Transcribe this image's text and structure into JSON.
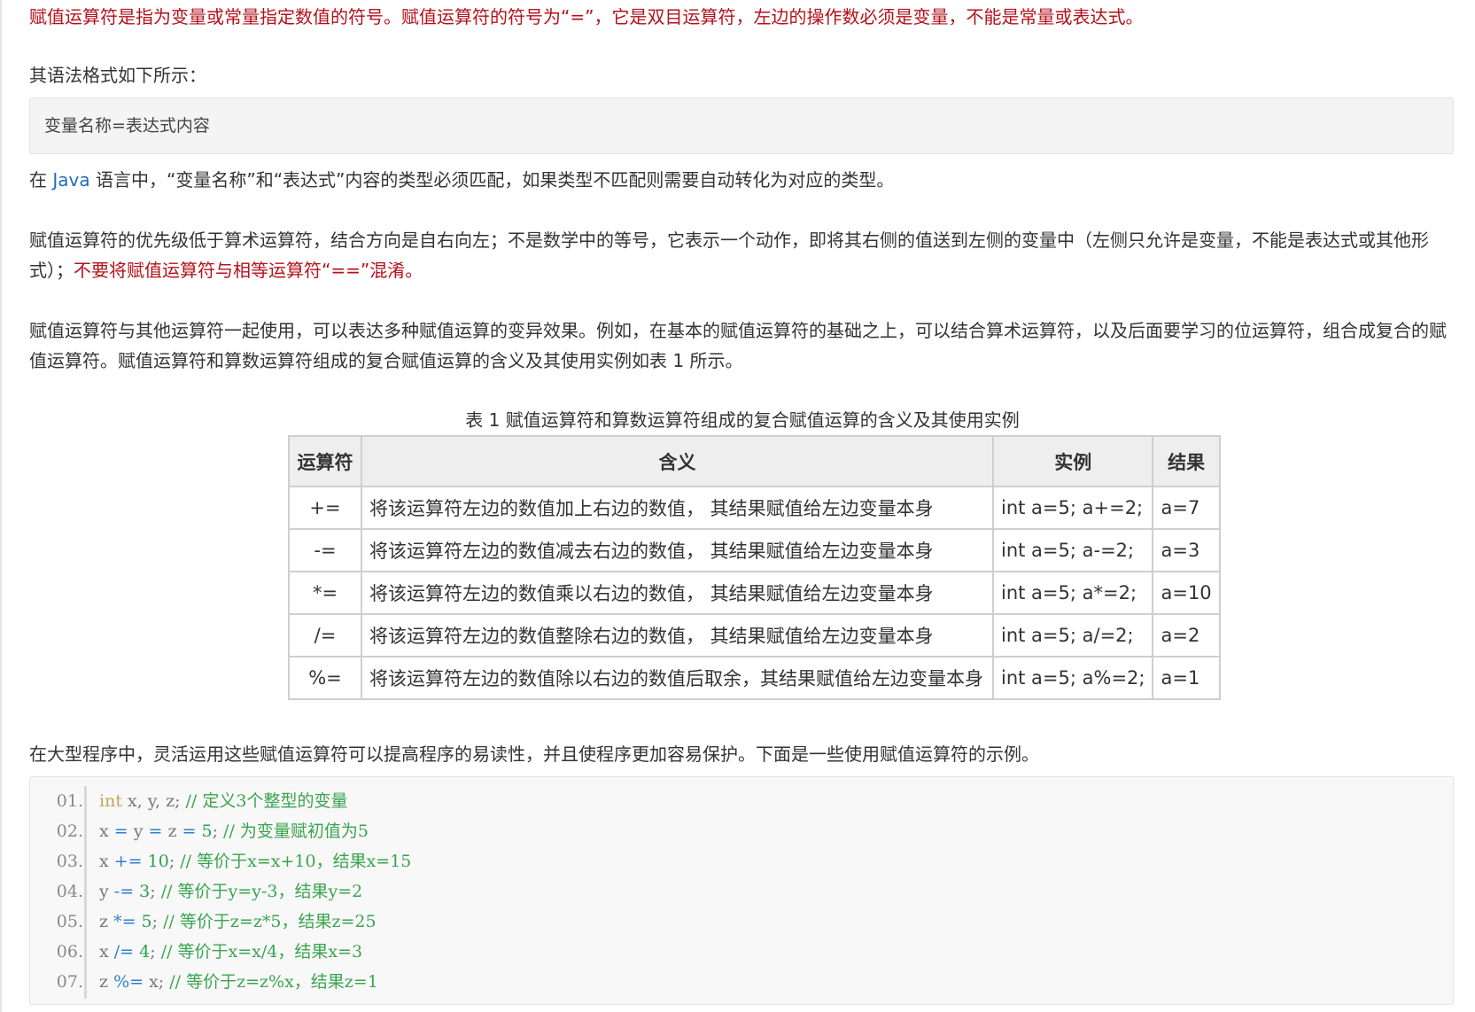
{
  "para1": "赋值运算符是指为变量或常量指定数值的符号。赋值运算符的符号为“=”，它是双目运算符，左边的操作数必须是变量，不能是常量或表达式。",
  "para2": "其语法格式如下所示：",
  "syntax": "变量名称=表达式内容",
  "para3": {
    "prefix": "在 ",
    "link": "Java",
    "suffix": " 语言中，“变量名称”和“表达式”内容的类型必须匹配，如果类型不匹配则需要自动转化为对应的类型。"
  },
  "para4": {
    "normal": "赋值运算符的优先级低于算术运算符，结合方向是自右向左；不是数学中的等号，它表示一个动作，即将其右侧的值送到左侧的变量中（左侧只允许是变量，不能是表达式或其他形式）；",
    "red": "不要将赋值运算符与相等运算符“==”混淆。"
  },
  "para5": "赋值运算符与其他运算符一起使用，可以表达多种赋值运算的变异效果。例如，在基本的赋值运算符的基础之上，可以结合算术运算符，以及后面要学习的位运算符，组合成复合的赋值运算符。赋值运算符和算数运算符组成的复合赋值运算的含义及其使用实例如表 1 所示。",
  "table": {
    "caption": "表 1 赋值运算符和算数运算符组成的复合赋值运算的含义及其使用实例",
    "headers": [
      "运算符",
      "含义",
      "实例",
      "结果"
    ],
    "rows": [
      [
        "+=",
        "将该运算符左边的数值加上右边的数值， 其结果赋值给左边变量本身",
        "int a=5; a+=2;",
        "a=7"
      ],
      [
        "-=",
        "将该运算符左边的数值减去右边的数值， 其结果赋值给左边变量本身",
        "int a=5; a-=2;",
        "a=3"
      ],
      [
        "*=",
        "将该运算符左边的数值乘以右边的数值， 其结果赋值给左边变量本身",
        "int a=5; a*=2;",
        "a=10"
      ],
      [
        "/=",
        "将该运算符左边的数值整除右边的数值， 其结果赋值给左边变量本身",
        "int a=5; a/=2;",
        "a=2"
      ],
      [
        "%=",
        "将该运算符左边的数值除以右边的数值后取余，其结果赋值给左边变量本身",
        "int a=5; a%=2;",
        "a=1"
      ]
    ]
  },
  "para6": "在大型程序中，灵活运用这些赋值运算符可以提高程序的易读性，并且使程序更加容易保护。下面是一些使用赋值运算符的示例。",
  "code": [
    {
      "num": "01.",
      "kw": "int",
      "a": " x, y, z; ",
      "c": "// 定义3个整型的变量"
    },
    {
      "num": "02.",
      "t1": "x ",
      "o1": "=",
      "t2": " y ",
      "o2": "=",
      "t3": " z ",
      "o3": "=",
      "n": " 5",
      "t4": "; ",
      "c": "// 为变量赋初值为5"
    },
    {
      "num": "03.",
      "t1": "x ",
      "o1": "+=",
      "n": " 10",
      "t4": "; ",
      "c": "// 等价于x=x+10，结果x=15"
    },
    {
      "num": "04.",
      "t1": "y ",
      "o1": "-=",
      "n": " 3",
      "t4": "; ",
      "c": "// 等价于y=y-3，结果y=2"
    },
    {
      "num": "05.",
      "t1": "z ",
      "o1": "*=",
      "n": " 5",
      "t4": "; ",
      "c": "// 等价于z=z*5，结果z=25"
    },
    {
      "num": "06.",
      "t1": "x ",
      "o1": "/=",
      "n": " 4",
      "t4": "; ",
      "c": "// 等价于x=x/4，结果x=3"
    },
    {
      "num": "07.",
      "t1": "z ",
      "o1": "%=",
      "t2": " x; ",
      "c": "// 等价于z=z%x，结果z=1"
    }
  ]
}
